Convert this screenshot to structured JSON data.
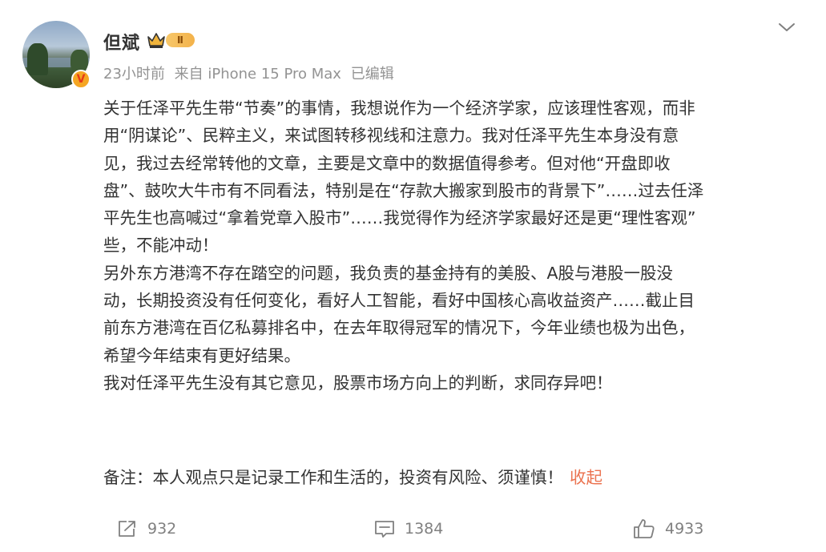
{
  "post": {
    "username": "但斌",
    "level_badge": "Ⅱ",
    "time": "23小时前",
    "source": "来自 iPhone 15 Pro Max",
    "edited": "已编辑",
    "verified_mark": "V"
  },
  "content": {
    "lines": [
      "关于任泽平先生带“节奏”的事情，我想说作为一个经济学家，应该理性客观，而非",
      "用“阴谋论”、民粹主义，来试图转移视线和注意力。我对任泽平先生本身没有意",
      "见，我过去经常转他的文章，主要是文章中的数据值得参考。但对他“开盘即收",
      "盘”、鼓吹大牛市有不同看法，特别是在“存款大搬家到股市的背景下”……过去任泽",
      "平先生也高喊过“拿着党章入股市”……我觉得作为经济学家最好还是更“理性客观”",
      "些，不能冲动！",
      "另外东方港湾不存在踏空的问题，我负责的基金持有的美股、A股与港股一股没",
      "动，长期投资没有任何变化，看好人工智能，看好中国核心高收益资产……截止目",
      "前东方港湾在百亿私募排名中，在去年取得冠军的情况下，今年业绩也极为出色，",
      "希望今年结束有更好结果。",
      "我对任泽平先生没有其它意见，股票市场方向上的判断，求同存异吧！"
    ],
    "note": "备注：本人观点只是记录工作和生活的，投资有风险、须谨慎！",
    "collapse_label": "收起"
  },
  "actions": {
    "repost_count": "932",
    "comment_count": "1384",
    "like_count": "4933"
  },
  "colors": {
    "text": "#333333",
    "meta": "#939393",
    "link": "#eb7350",
    "action": "#808080"
  }
}
